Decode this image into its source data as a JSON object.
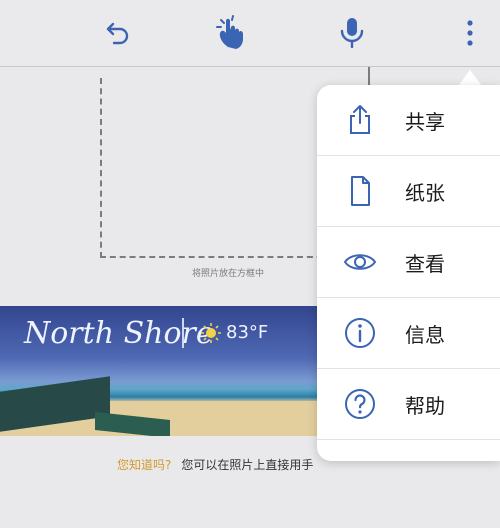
{
  "toolbar": {
    "icons": [
      "undo-icon",
      "touch-icon",
      "microphone-icon",
      "more-icon"
    ]
  },
  "canvas": {
    "frame_caption": "将照片放在方框中",
    "banner": {
      "title": "North Shore",
      "temperature": "83°F"
    },
    "tip": {
      "question": "您知道吗?",
      "text": "您可以在照片上直接用手"
    }
  },
  "menu": {
    "items": [
      {
        "icon": "share-icon",
        "label": "共享"
      },
      {
        "icon": "paper-icon",
        "label": "纸张"
      },
      {
        "icon": "eye-icon",
        "label": "查看"
      },
      {
        "icon": "info-icon",
        "label": "信息"
      },
      {
        "icon": "help-icon",
        "label": "帮助"
      }
    ]
  },
  "colors": {
    "accent": "#3b64b3",
    "toolbar_bg": "#eaeaec",
    "tip_highlight": "#d49a2c"
  }
}
